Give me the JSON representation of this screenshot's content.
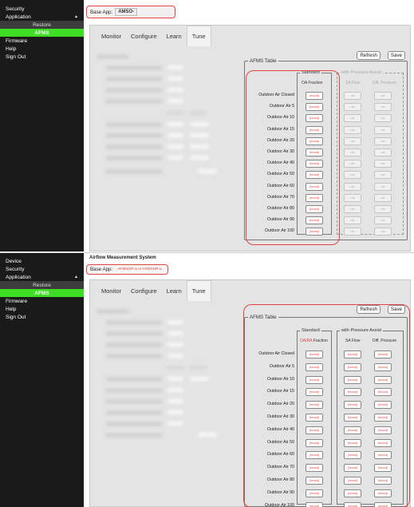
{
  "top": {
    "sidebar": [
      {
        "label": "Security"
      },
      {
        "label": "Application",
        "expanded": true
      },
      {
        "label": "Restore",
        "sub": true
      },
      {
        "label": "AFMS",
        "active": true
      },
      {
        "label": "Firmware"
      },
      {
        "label": "Help"
      },
      {
        "label": "Sign Out"
      }
    ],
    "base_app_label": "Base App:",
    "base_app_value": "AMSO-",
    "tabs": [
      "Monitor",
      "Configure",
      "Learn",
      "Tune"
    ],
    "active_tab": "Tune",
    "table_title": "AFMS Table",
    "refresh_label": "Refresh",
    "save_label": "Save",
    "standard_legend": "Standard",
    "oa_head": "OA Fraction",
    "pressure_legend": "with Pressure Assist",
    "sa_head": "SA Flow",
    "diff_head": "Diff. Pressure",
    "record": "[record]",
    "na": "n/a",
    "rows": [
      "Outdoor Air Closed",
      "Outdoor Air 5",
      "Outdoor Air 10",
      "Outdoor Air 15",
      "Outdoor Air 20",
      "Outdoor Air 30",
      "Outdoor Air 40",
      "Outdoor Air 50",
      "Outdoor Air 60",
      "Outdoor Air 70",
      "Outdoor Air 80",
      "Outdoor Air 90",
      "Outdoor Air 100"
    ]
  },
  "bottom": {
    "sidebar": [
      {
        "label": "Device"
      },
      {
        "label": "Security"
      },
      {
        "label": "Application",
        "expanded": true
      },
      {
        "label": "Restore",
        "sub": true
      },
      {
        "label": "AFMS",
        "active": true
      },
      {
        "label": "Firmware"
      },
      {
        "label": "Help"
      },
      {
        "label": "Sign Out"
      }
    ],
    "page_title": "Airflow Measurement System",
    "base_app_label": "Base App:",
    "base_app_value": "AFMSOP-a or AFMSHP-a",
    "tabs": [
      "Monitor",
      "Configure",
      "Learn",
      "Tune"
    ],
    "active_tab": "Tune",
    "table_title": "AFMS Table",
    "refresh_label": "Refresh",
    "save_label": "Save",
    "standard_legend": "Standard",
    "oa_head_warn": "OA/RA",
    "oa_head_rest": "Fraction",
    "pressure_legend": "with Pressure Assist",
    "sa_head": "SA Flow",
    "diff_head": "Diff. Pressure",
    "record": "[record]",
    "rows": [
      "Outdoor Air Closed",
      "Outdoor Air 5",
      "Outdoor Air 10",
      "Outdoor Air 15",
      "Outdoor Air 20",
      "Outdoor Air 30",
      "Outdoor Air 40",
      "Outdoor Air 50",
      "Outdoor Air 60",
      "Outdoor Air 70",
      "Outdoor Air 80",
      "Outdoor Air 90",
      "Outdoor Air 100"
    ]
  },
  "colors": {
    "sidebar_bg": "#1a1a1a",
    "active_green": "#3dde24",
    "highlight_red": "#e0463f",
    "panel_gray": "#e4e4e4"
  }
}
